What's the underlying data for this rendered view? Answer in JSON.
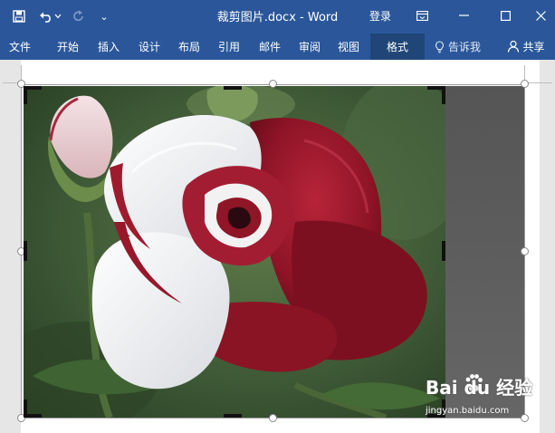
{
  "title_bar": {
    "document_title": "裁剪图片.docx - Word",
    "login": "登录",
    "customize_symbol": "⌄"
  },
  "ribbon": {
    "tabs": [
      "文件",
      "开始",
      "插入",
      "设计",
      "布局",
      "引用",
      "邮件",
      "审阅",
      "视图"
    ],
    "format_tab": "格式",
    "tell_me": "告诉我",
    "share": "共享"
  },
  "watermark": {
    "main": "Bai du 经验",
    "sub": "jingyan.baidu.com"
  },
  "colors": {
    "ribbon": "#2b579a",
    "active_tab": "#1f4677",
    "rose_red": "#8e1426"
  },
  "icons": [
    "save-icon",
    "undo-icon",
    "undo-dropdown-icon",
    "redo-icon",
    "ribbon-display-icon",
    "minimize-icon",
    "maximize-icon",
    "close-icon",
    "lightbulb-icon",
    "person-icon",
    "paw-icon"
  ]
}
